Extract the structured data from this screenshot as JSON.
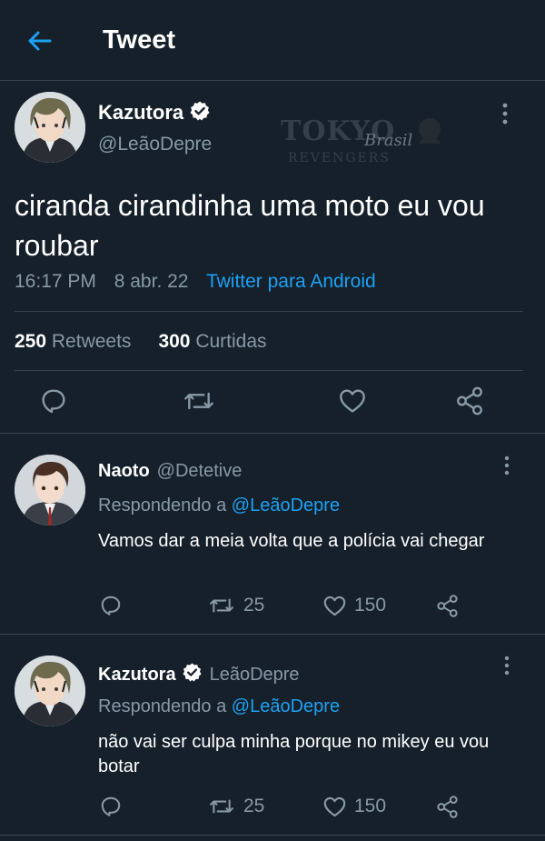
{
  "header": {
    "title": "Tweet"
  },
  "main_tweet": {
    "display_name": "Kazutora",
    "handle": "@LeãoDepre",
    "watermark": "TOKYO Brasil REVENGERS",
    "text": "ciranda cirandinha uma moto eu vou roubar",
    "time": "16:17 PM",
    "date": "8 abr. 22",
    "source": "Twitter para Android",
    "retweets_count": "250",
    "retweets_label": "Retweets",
    "likes_count": "300",
    "likes_label": "Curtidas"
  },
  "replies": [
    {
      "display_name": "Naoto",
      "handle": "@Detetive",
      "replying_prefix": "Respondendo a",
      "replying_to": "@LeãoDepre",
      "text": "Vamos dar a meia volta que a polícia vai chegar",
      "retweets": "25",
      "likes": "150"
    },
    {
      "display_name": "Kazutora",
      "handle": "LeãoDepre",
      "replying_prefix": "Respondendo a",
      "replying_to": "@LeãoDepre",
      "text": "não vai ser culpa minha porque no mikey eu vou botar",
      "retweets": "25",
      "likes": "150"
    }
  ],
  "colors": {
    "background": "#15202b",
    "text": "#ffffff",
    "muted": "#8899a6",
    "accent": "#1da1f2",
    "divider": "#38444d"
  },
  "icons": [
    "back-arrow-icon",
    "verified-badge-icon",
    "more-vertical-icon",
    "reply-icon",
    "retweet-icon",
    "like-icon",
    "share-icon"
  ]
}
